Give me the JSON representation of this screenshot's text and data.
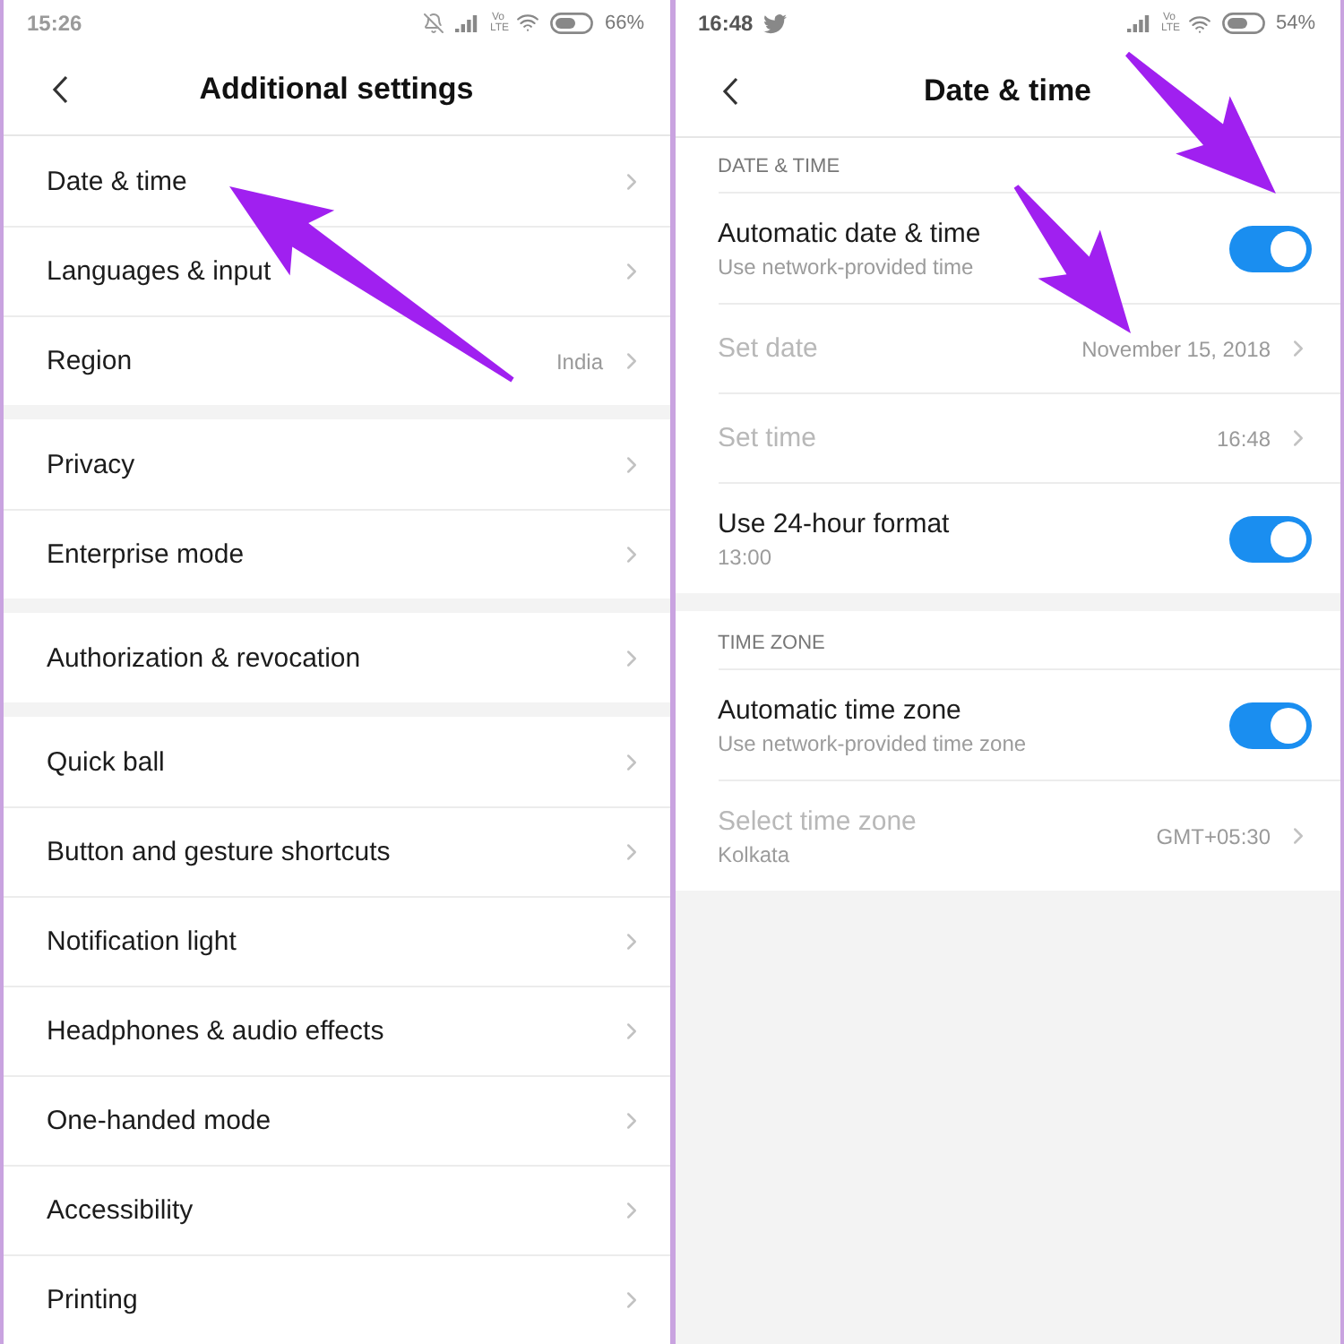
{
  "screens": [
    {
      "kind": "list",
      "status_bar": {
        "time": "15:26",
        "network": "Vo LTE",
        "battery": "66%"
      },
      "title": "Additional settings",
      "groups": [
        {
          "items": [
            {
              "label": "Date & time"
            },
            {
              "label": "Languages & input"
            },
            {
              "label": "Region",
              "value": "India"
            }
          ]
        },
        {
          "items": [
            {
              "label": "Privacy"
            },
            {
              "label": "Enterprise mode"
            }
          ]
        },
        {
          "items": [
            {
              "label": "Authorization & revocation"
            }
          ]
        },
        {
          "items": [
            {
              "label": "Quick ball"
            },
            {
              "label": "Button and gesture shortcuts"
            },
            {
              "label": "Notification light"
            },
            {
              "label": "Headphones & audio effects"
            },
            {
              "label": "One-handed mode"
            },
            {
              "label": "Accessibility"
            },
            {
              "label": "Printing"
            }
          ]
        }
      ]
    },
    {
      "kind": "detail",
      "status_bar": {
        "time": "16:48",
        "network": "Vo LTE",
        "battery": "54%"
      },
      "title": "Date & time",
      "sections": [
        {
          "header": "DATE & TIME",
          "rows": [
            {
              "kind": "switch",
              "label": "Automatic date & time",
              "subtitle": "Use network-provided time",
              "on": true
            },
            {
              "kind": "link",
              "label": "Set date",
              "value": "November 15, 2018",
              "disabled": true
            },
            {
              "kind": "link",
              "label": "Set time",
              "value": "16:48",
              "disabled": true
            },
            {
              "kind": "switch",
              "label": "Use 24-hour format",
              "subtitle": "13:00",
              "on": true
            }
          ]
        },
        {
          "header": "TIME ZONE",
          "rows": [
            {
              "kind": "switch",
              "label": "Automatic time zone",
              "subtitle": "Use network-provided time zone",
              "on": true
            },
            {
              "kind": "link",
              "label": "Select time zone",
              "subtitle": "Kolkata",
              "value": "GMT+05:30",
              "disabled": true
            }
          ]
        }
      ]
    }
  ]
}
